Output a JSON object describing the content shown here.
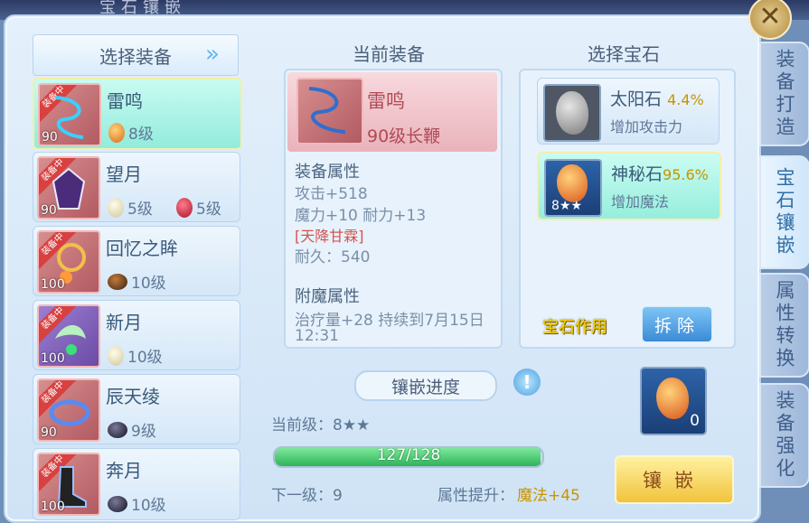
{
  "window": {
    "bg_title": "宝石镶嵌"
  },
  "side_tabs": [
    "装备打造",
    "宝石镶嵌",
    "属性转换",
    "装备强化"
  ],
  "equip_list": {
    "header": "选择装备",
    "items": [
      {
        "name": "雷鸣",
        "level": "90",
        "equipped": true,
        "badge": "装备中",
        "gems": [
          {
            "icon": "orange-stone",
            "label": "8级"
          }
        ]
      },
      {
        "name": "望月",
        "level": "90",
        "equipped": true,
        "badge": "装备中",
        "gems": [
          {
            "icon": "pearl-stone",
            "label": "5级"
          },
          {
            "icon": "red-stone",
            "label": "5级"
          }
        ]
      },
      {
        "name": "回忆之眸",
        "level": "100",
        "equipped": true,
        "badge": "装备中",
        "gems": [
          {
            "icon": "brown-stone",
            "label": "10级"
          }
        ]
      },
      {
        "name": "新月",
        "level": "100",
        "equipped": true,
        "badge": "装备中",
        "gems": [
          {
            "icon": "pearl-stone",
            "label": "10级"
          }
        ]
      },
      {
        "name": "辰天绫",
        "level": "90",
        "equipped": true,
        "badge": "装备中",
        "gems": [
          {
            "icon": "dark-stone",
            "label": "9级"
          }
        ]
      },
      {
        "name": "奔月",
        "level": "100",
        "equipped": true,
        "badge": "装备中",
        "gems": [
          {
            "icon": "dark-stone",
            "label": "10级"
          }
        ]
      }
    ]
  },
  "current": {
    "header": "当前装备",
    "name": "雷鸣",
    "type": "90级长鞭",
    "attr_title": "装备属性",
    "attrs": [
      "攻击+518",
      "魔力+10 耐力+13",
      "[天降甘霖]",
      "耐久：540"
    ],
    "enchant_title": "附魔属性",
    "enchant": [
      "治疗量+28 持续到7月15日",
      "12:31"
    ]
  },
  "gems": {
    "header": "选择宝石",
    "cards": [
      {
        "name": "太阳石",
        "pct": "4.4%",
        "desc": "增加攻击力"
      },
      {
        "name": "神秘石",
        "pct": "95.6%",
        "desc": "增加魔法",
        "level": "8★★"
      }
    ],
    "effect_label": "宝石作用",
    "remove_label": "拆除"
  },
  "progress": {
    "title": "镶嵌进度",
    "current_level": "当前级：8★★",
    "value": "127/128",
    "fraction": 0.992,
    "next_level": "下一级：9",
    "boost_label": "属性提升：",
    "boost_value": "魔法+45"
  },
  "slot": {
    "count": "0"
  },
  "inlay_button": "镶嵌"
}
